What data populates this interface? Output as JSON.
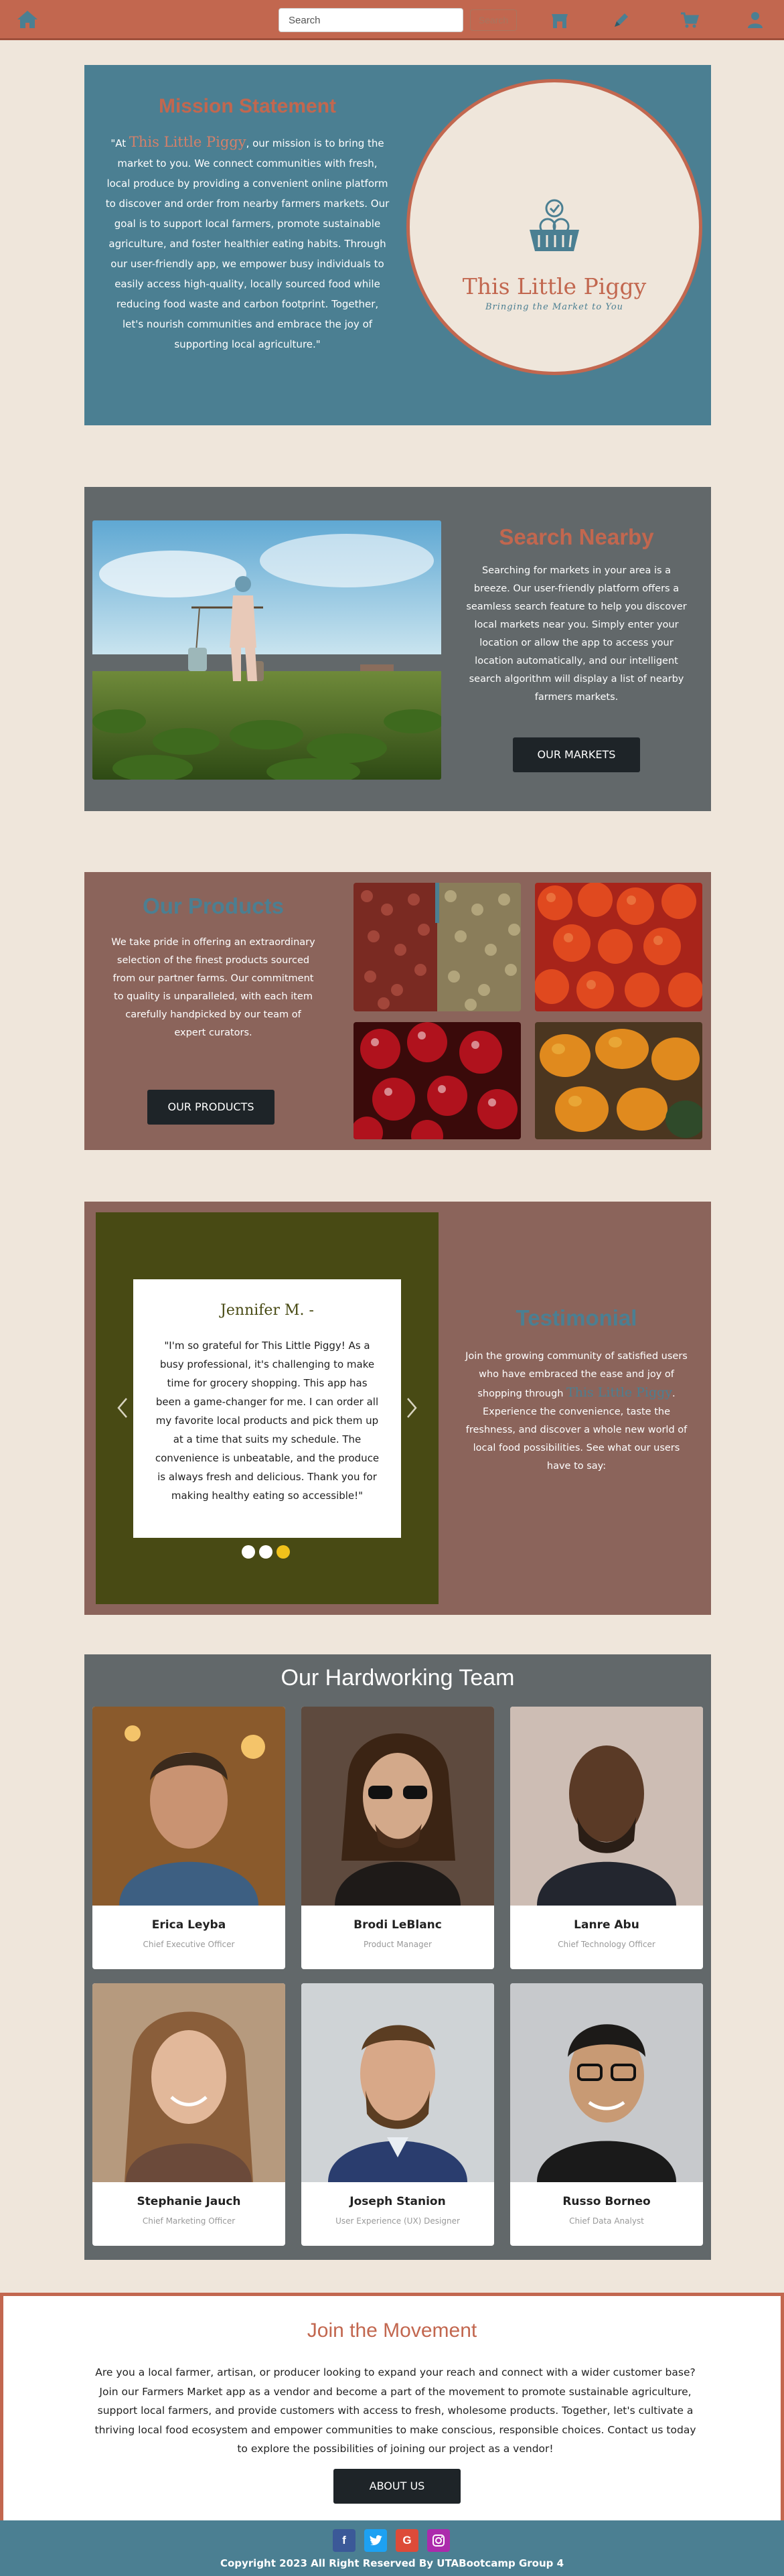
{
  "nav": {
    "search_placeholder": "Search",
    "search_button": "Search",
    "icons": [
      "home-icon",
      "market-icon",
      "vendor-icon",
      "cart-icon",
      "user-icon"
    ]
  },
  "mission": {
    "title": "Mission Statement",
    "text_open": "\"At ",
    "brand": "This Little Piggy",
    "text_rest": ", our mission is to bring the market to you. We connect communities with fresh, local produce by providing a convenient online platform to discover and order from nearby farmers markets. Our goal is to support local farmers, promote sustainable agriculture, and foster healthier eating habits. Through our user-friendly app, we empower busy individuals to easily access high-quality, locally sourced food while reducing food waste and carbon footprint. Together, let's nourish communities and embrace the joy of supporting local agriculture.\"",
    "logo_title": "This Little Piggy",
    "logo_tagline": "Bringing the Market to You"
  },
  "nearby": {
    "title": "Search Nearby",
    "text": "Searching for markets in your area is a breeze. Our user-friendly platform offers a seamless search feature to help you discover local markets near you. Simply enter your location or allow the app to access your location automatically, and our intelligent search algorithm will display a list of nearby farmers markets.",
    "button": "OUR MARKETS"
  },
  "products": {
    "title": "Our Products",
    "text": "We take pride in offering an extraordinary selection of the finest products sourced from our partner farms. Our commitment to quality is unparalleled, with each item carefully handpicked by our team of expert curators.",
    "button": "OUR PRODUCTS"
  },
  "testimonial": {
    "name": "Jennifer M. -",
    "quote": "\"I'm so grateful for This Little Piggy! As a busy professional, it's challenging to make time for grocery shopping. This app has been a game-changer for me. I can order all my favorite local products and pick them up at a time that suits my schedule. The convenience is unbeatable, and the produce is always fresh and delicious. Thank you for making healthy eating so accessible!\"",
    "title": "Testimonial",
    "text_before": "Join the growing community of satisfied users who have embraced the ease and joy of shopping through ",
    "brand": "This Little Piggy",
    "text_after": ". Experience the convenience, taste the freshness, and discover a whole new world of local food possibilities. See what our users have to say:"
  },
  "team": {
    "title": "Our Hardworking Team",
    "members": [
      {
        "name": "Erica Leyba",
        "role": "Chief Executive Officer"
      },
      {
        "name": "Brodi LeBlanc",
        "role": "Product Manager"
      },
      {
        "name": "Lanre Abu",
        "role": "Chief Technology Officer"
      },
      {
        "name": "Stephanie Jauch",
        "role": "Chief Marketing Officer"
      },
      {
        "name": "Joseph Stanion",
        "role": "User Experience (UX) Designer"
      },
      {
        "name": "Russo Borneo",
        "role": "Chief Data Analyst"
      }
    ]
  },
  "join": {
    "title": "Join the Movement",
    "text": "Are you a local farmer, artisan, or producer looking to expand your reach and connect with a wider customer base? Join our Farmers Market app as a vendor and become a part of the movement to promote sustainable agriculture, support local farmers, and provide customers with access to fresh, wholesome products. Together, let's cultivate a thriving local food ecosystem and empower communities to make conscious, responsible choices. Contact us today to explore the possibilities of joining our project as a vendor!",
    "button": "ABOUT US"
  },
  "footer": {
    "social": [
      "f",
      "",
      "G",
      ""
    ],
    "copyright": "Copyright 2023 All Right Reserved By UTABootcamp Group 4"
  },
  "colors": {
    "terracotta": "#c2674f",
    "teal": "#4b7f92",
    "slate": "#62686a",
    "mauve": "#8b645b",
    "olive": "#484a14",
    "cream": "#efe6db"
  }
}
